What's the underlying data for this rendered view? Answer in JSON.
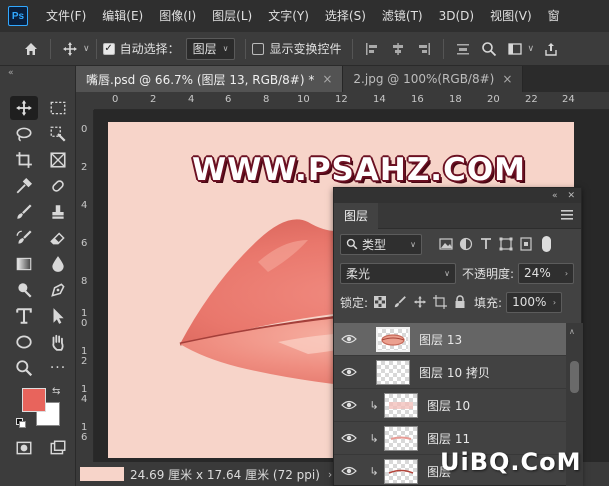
{
  "app": {
    "logo": "Ps"
  },
  "menu": [
    "文件(F)",
    "编辑(E)",
    "图像(I)",
    "图层(L)",
    "文字(Y)",
    "选择(S)",
    "滤镜(T)",
    "3D(D)",
    "视图(V)",
    "窗"
  ],
  "options": {
    "auto_select_label": "自动选择：",
    "auto_select_value": "图层",
    "show_transform_label": "显示变换控件"
  },
  "tabs": [
    {
      "label": "嘴唇.psd @ 66.7% (图层 13, RGB/8#) *",
      "close": "×"
    },
    {
      "label": "2.jpg @ 100%(RGB/8#)",
      "close": "×"
    }
  ],
  "ruler_top_ticks": [
    "0",
    "2",
    "4",
    "6",
    "8",
    "10",
    "12",
    "14",
    "16",
    "18",
    "20",
    "22",
    "24"
  ],
  "ruler_left_ticks": [
    "0",
    "2",
    "4",
    "6",
    "8",
    "1",
    "0",
    "1",
    "2",
    "1",
    "4",
    "1",
    "6"
  ],
  "canvas": {
    "watermark": "WWW.PSAHZ.COM",
    "background": "#f7d4c9"
  },
  "status": {
    "text": "24.69 厘米 x 17.64 厘米 (72 ppi)",
    "arrow": "›"
  },
  "colors": {
    "foreground": "#e8645c",
    "background": "#ffffff",
    "accent": "#31a8ff"
  },
  "layers_panel": {
    "title": "图层",
    "filter_label": "类型",
    "blend_mode": "柔光",
    "opacity_label": "不透明度:",
    "opacity_value": "24%",
    "lock_label": "锁定:",
    "fill_label": "填充:",
    "fill_value": "100%",
    "layers": [
      {
        "name": "图层 13",
        "selected": true,
        "clipped": false
      },
      {
        "name": "图层 10 拷贝",
        "selected": false,
        "clipped": false
      },
      {
        "name": "图层 10",
        "selected": false,
        "clipped": true
      },
      {
        "name": "图层 11",
        "selected": false,
        "clipped": true
      },
      {
        "name": "图层",
        "selected": false,
        "clipped": true
      }
    ]
  },
  "site_watermark": "UiBQ.CoM"
}
